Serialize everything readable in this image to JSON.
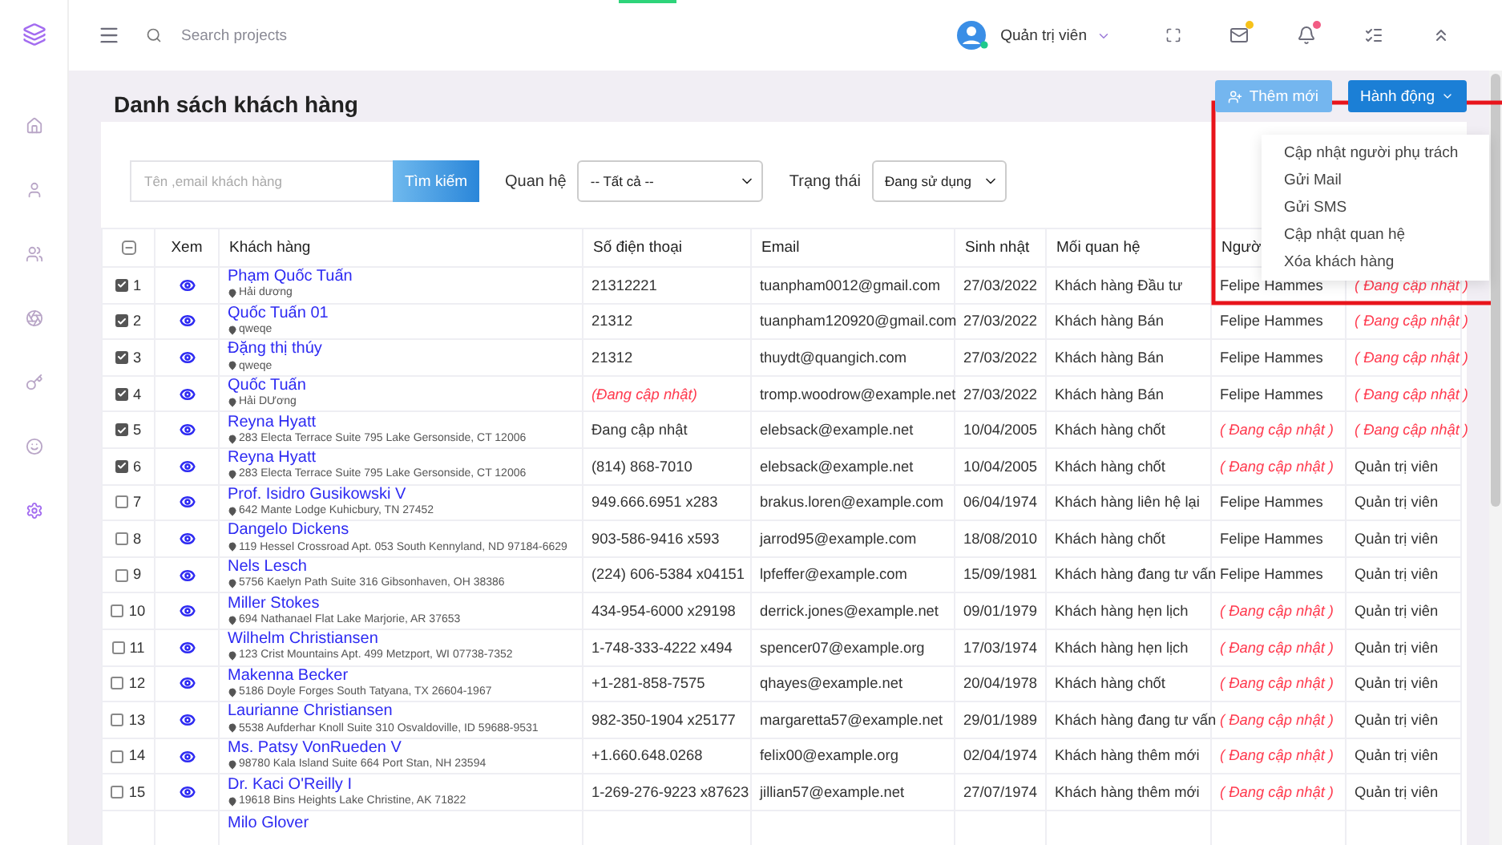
{
  "topbar": {
    "search": {
      "placeholder": "Search projects"
    },
    "user": "Quản trị viên"
  },
  "sidebar": {
    "items": [
      {
        "selected": false
      },
      {
        "selected": false
      },
      {
        "selected": false
      },
      {
        "selected": false
      },
      {
        "selected": false
      },
      {
        "selected": false
      },
      {
        "selected": true
      }
    ]
  },
  "page": {
    "title": "Danh sách khách hàng",
    "buttons": [
      {
        "label": "Thêm mới",
        "kind": "add"
      },
      {
        "label": "Hành động",
        "kind": "menu"
      }
    ]
  },
  "action_menu": {
    "items": [
      "Cập nhật người phụ trách",
      "Gửi Mail",
      "Gửi SMS",
      "Cập nhật quan hệ",
      "Xóa khách hàng"
    ]
  },
  "filters": {
    "search": {
      "placeholder": "Tên ,email khách hàng"
    },
    "search_button": "Tìm kiếm",
    "relation_label": "Quan hệ",
    "relation_value": "-- Tất cả --",
    "status_label": "Trạng thái",
    "status_value": "Đang sử dụng"
  },
  "table": {
    "select_all_indeterminate": true,
    "columns": [
      "Xem",
      "Khách hàng",
      "Số điện thoại",
      "Email",
      "Sinh nhật",
      "Mối quan hệ",
      "Ngườ"
    ],
    "rows": [
      {
        "checked": true,
        "no": "1",
        "name": "Phạm Quốc Tuấn",
        "address": "Hải dương",
        "phone": {
          "text": "21312221",
          "pending": false
        },
        "email": "tuanpham0012@gmail.com",
        "birthday": "27/03/2022",
        "relation": "Khách hàng Đầu tư",
        "staff": {
          "text": "Felipe Hammes",
          "pending": false
        },
        "creator": {
          "text": "( Đang cập nhật )",
          "pending": true
        }
      },
      {
        "checked": true,
        "no": "2",
        "name": "Quốc Tuấn 01",
        "address": "qweqe",
        "phone": {
          "text": "21312",
          "pending": false
        },
        "email": "tuanpham120920@gmail.com",
        "birthday": "27/03/2022",
        "relation": "Khách hàng Bán",
        "staff": {
          "text": "Felipe Hammes",
          "pending": false
        },
        "creator": {
          "text": "( Đang cập nhật )",
          "pending": true
        }
      },
      {
        "checked": true,
        "no": "3",
        "name": "Đặng thị thúy",
        "address": "qweqe",
        "phone": {
          "text": "21312",
          "pending": false
        },
        "email": "thuydt@quangich.com",
        "birthday": "27/03/2022",
        "relation": "Khách hàng Bán",
        "staff": {
          "text": "Felipe Hammes",
          "pending": false
        },
        "creator": {
          "text": "( Đang cập nhật )",
          "pending": true
        }
      },
      {
        "checked": true,
        "no": "4",
        "name": "Quốc Tuấn",
        "address": "Hải DƯơng",
        "phone": {
          "text": "(Đang cập nhật)",
          "pending": true
        },
        "email": "tromp.woodrow@example.net",
        "birthday": "27/03/2022",
        "relation": "Khách hàng Bán",
        "staff": {
          "text": "Felipe Hammes",
          "pending": false
        },
        "creator": {
          "text": "( Đang cập nhật )",
          "pending": true
        }
      },
      {
        "checked": true,
        "no": "5",
        "name": "Reyna Hyatt",
        "address": "283 Electa Terrace Suite 795 Lake Gersonside, CT 12006",
        "phone": {
          "text": "Đang cập nhật",
          "pending": false
        },
        "email": "elebsack@example.net",
        "birthday": "10/04/2005",
        "relation": "Khách hàng chốt",
        "staff": {
          "text": "( Đang cập nhật )",
          "pending": true
        },
        "creator": {
          "text": "( Đang cập nhật )",
          "pending": true
        }
      },
      {
        "checked": true,
        "no": "6",
        "name": "Reyna Hyatt",
        "address": "283 Electa Terrace Suite 795 Lake Gersonside, CT 12006",
        "phone": {
          "text": "(814) 868-7010",
          "pending": false
        },
        "email": "elebsack@example.net",
        "birthday": "10/04/2005",
        "relation": "Khách hàng chốt",
        "staff": {
          "text": "( Đang cập nhật )",
          "pending": true
        },
        "creator": {
          "text": "Quản trị viên",
          "pending": false
        }
      },
      {
        "checked": false,
        "no": "7",
        "name": "Prof. Isidro Gusikowski V",
        "address": "642 Mante Lodge Kuhicbury, TN 27452",
        "phone": {
          "text": "949.666.6951 x283",
          "pending": false
        },
        "email": "brakus.loren@example.com",
        "birthday": "06/04/1974",
        "relation": "Khách hàng liên hệ lại",
        "staff": {
          "text": "Felipe Hammes",
          "pending": false
        },
        "creator": {
          "text": "Quản trị viên",
          "pending": false
        }
      },
      {
        "checked": false,
        "no": "8",
        "name": "Dangelo Dickens",
        "address": "119 Hessel Crossroad Apt. 053 South Kennyland, ND 97184-6629",
        "phone": {
          "text": "903-586-9416 x593",
          "pending": false
        },
        "email": "jarrod95@example.com",
        "birthday": "18/08/2010",
        "relation": "Khách hàng chốt",
        "staff": {
          "text": "Felipe Hammes",
          "pending": false
        },
        "creator": {
          "text": "Quản trị viên",
          "pending": false
        }
      },
      {
        "checked": false,
        "no": "9",
        "name": "Nels Lesch",
        "address": "5756 Kaelyn Path Suite 316 Gibsonhaven, OH 38386",
        "phone": {
          "text": "(224) 606-5384 x04151",
          "pending": false
        },
        "email": "lpfeffer@example.com",
        "birthday": "15/09/1981",
        "relation": "Khách hàng đang tư vấn",
        "staff": {
          "text": "Felipe Hammes",
          "pending": false
        },
        "creator": {
          "text": "Quản trị viên",
          "pending": false
        }
      },
      {
        "checked": false,
        "no": "10",
        "name": "Miller Stokes",
        "address": "694 Nathanael Flat Lake Marjorie, AR 37653",
        "phone": {
          "text": "434-954-6000 x29198",
          "pending": false
        },
        "email": "derrick.jones@example.net",
        "birthday": "09/01/1979",
        "relation": "Khách hàng hẹn lịch",
        "staff": {
          "text": "( Đang cập nhật )",
          "pending": true
        },
        "creator": {
          "text": "Quản trị viên",
          "pending": false
        }
      },
      {
        "checked": false,
        "no": "11",
        "name": "Wilhelm Christiansen",
        "address": "123 Crist Mountains Apt. 499 Metzport, WI 07738-7352",
        "phone": {
          "text": "1-748-333-4222 x494",
          "pending": false
        },
        "email": "spencer07@example.org",
        "birthday": "17/03/1974",
        "relation": "Khách hàng hẹn lịch",
        "staff": {
          "text": "( Đang cập nhật )",
          "pending": true
        },
        "creator": {
          "text": "Quản trị viên",
          "pending": false
        }
      },
      {
        "checked": false,
        "no": "12",
        "name": "Makenna Becker",
        "address": "5186 Doyle Forges South Tatyana, TX 26604-1967",
        "phone": {
          "text": "+1-281-858-7575",
          "pending": false
        },
        "email": "qhayes@example.net",
        "birthday": "20/04/1978",
        "relation": "Khách hàng chốt",
        "staff": {
          "text": "( Đang cập nhật )",
          "pending": true
        },
        "creator": {
          "text": "Quản trị viên",
          "pending": false
        }
      },
      {
        "checked": false,
        "no": "13",
        "name": "Laurianne Christiansen",
        "address": "5538 Aufderhar Knoll Suite 310 Osvaldoville, ID 59688-9531",
        "phone": {
          "text": "982-350-1904 x25177",
          "pending": false
        },
        "email": "margaretta57@example.net",
        "birthday": "29/01/1989",
        "relation": "Khách hàng đang tư vấn",
        "staff": {
          "text": "( Đang cập nhật )",
          "pending": true
        },
        "creator": {
          "text": "Quản trị viên",
          "pending": false
        }
      },
      {
        "checked": false,
        "no": "14",
        "name": "Ms. Patsy VonRueden V",
        "address": "98780 Kala Island Suite 664 Port Stan, NH 23594",
        "phone": {
          "text": "+1.660.648.0268",
          "pending": false
        },
        "email": "felix00@example.org",
        "birthday": "02/04/1974",
        "relation": "Khách hàng thêm mới",
        "staff": {
          "text": "( Đang cập nhật )",
          "pending": true
        },
        "creator": {
          "text": "Quản trị viên",
          "pending": false
        }
      },
      {
        "checked": false,
        "no": "15",
        "name": "Dr. Kaci O'Reilly I",
        "address": "19618 Bins Heights Lake Christine, AK 71822",
        "phone": {
          "text": "1-269-276-9223 x87623",
          "pending": false
        },
        "email": "jillian57@example.net",
        "birthday": "27/07/1974",
        "relation": "Khách hàng thêm mới",
        "staff": {
          "text": "( Đang cập nhật )",
          "pending": true
        },
        "creator": {
          "text": "Quản trị viên",
          "pending": false
        }
      },
      {
        "name": "Milo Glover"
      }
    ]
  }
}
